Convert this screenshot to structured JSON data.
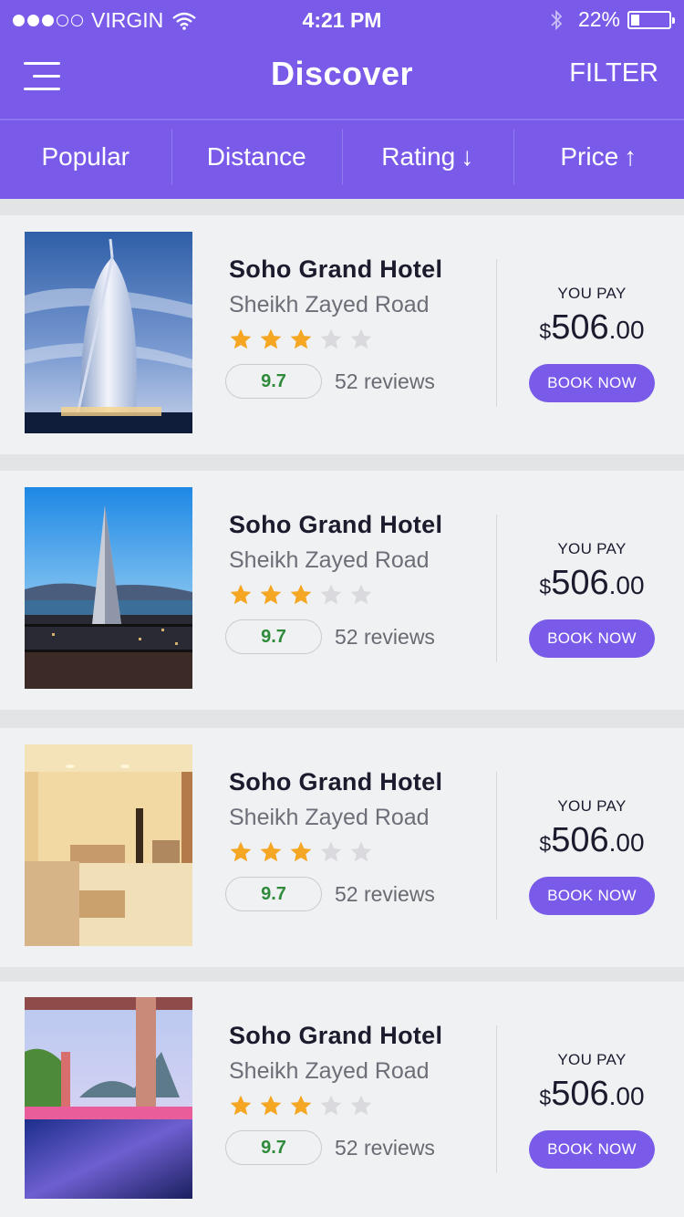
{
  "status_bar": {
    "carrier": "VIRGIN",
    "time": "4:21 PM",
    "battery": "22%"
  },
  "nav": {
    "title": "Discover",
    "filter_label": "FILTER"
  },
  "sort_tabs": [
    {
      "label": "Popular",
      "arrow": ""
    },
    {
      "label": "Distance",
      "arrow": ""
    },
    {
      "label": "Rating",
      "arrow": "↓"
    },
    {
      "label": "Price",
      "arrow": "↑"
    }
  ],
  "colors": {
    "accent": "#7a5be9",
    "star": "#f5a623",
    "star_empty": "#d9d9de",
    "score": "#2f8a3a"
  },
  "hotels": [
    {
      "name": "Soho Grand Hotel",
      "address": "Sheikh Zayed Road",
      "stars": 3,
      "max_stars": 5,
      "score": "9.7",
      "reviews": "52 reviews",
      "pay_label": "YOU PAY",
      "currency": "$",
      "price_whole": "506",
      "price_cents": ".00",
      "book_label": "BOOK NOW",
      "photo": "sail-tower-photo"
    },
    {
      "name": "Soho Grand Hotel",
      "address": "Sheikh Zayed Road",
      "stars": 3,
      "max_stars": 5,
      "score": "9.7",
      "reviews": "52 reviews",
      "pay_label": "YOU PAY",
      "currency": "$",
      "price_whole": "506",
      "price_cents": ".00",
      "book_label": "BOOK NOW",
      "photo": "pyramid-tower-photo"
    },
    {
      "name": "Soho Grand Hotel",
      "address": "Sheikh Zayed Road",
      "stars": 3,
      "max_stars": 5,
      "score": "9.7",
      "reviews": "52 reviews",
      "pay_label": "YOU PAY",
      "currency": "$",
      "price_whole": "506",
      "price_cents": ".00",
      "book_label": "BOOK NOW",
      "photo": "hotel-room-photo"
    },
    {
      "name": "Soho Grand Hotel",
      "address": "Sheikh Zayed Road",
      "stars": 3,
      "max_stars": 5,
      "score": "9.7",
      "reviews": "52 reviews",
      "pay_label": "YOU PAY",
      "currency": "$",
      "price_whole": "506",
      "price_cents": ".00",
      "book_label": "BOOK NOW",
      "photo": "pool-terrace-photo"
    }
  ]
}
